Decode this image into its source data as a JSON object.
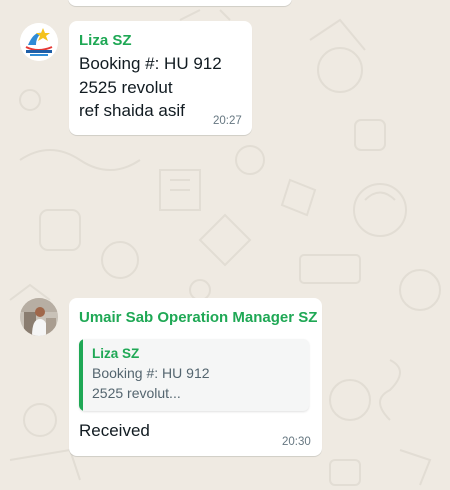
{
  "messages": [
    {
      "sender": "Liza SZ",
      "lines": [
        "Booking #: HU 912",
        "2525 revolut",
        "ref shaida asif"
      ],
      "time": "20:27",
      "avatar_icon": "seven-zones-travel-logo"
    },
    {
      "sender": "Umair Sab Operation Manager SZ",
      "quoted": {
        "sender": "Liza SZ",
        "lines": [
          "Booking #: HU 912",
          "2525 revolut..."
        ]
      },
      "text": "Received",
      "time": "20:30",
      "avatar_icon": "user-photo-avatar"
    }
  ],
  "colors": {
    "background": "#efeae2",
    "bubble": "#ffffff",
    "sender_name": "#1fa855",
    "timestamp": "#667781"
  }
}
